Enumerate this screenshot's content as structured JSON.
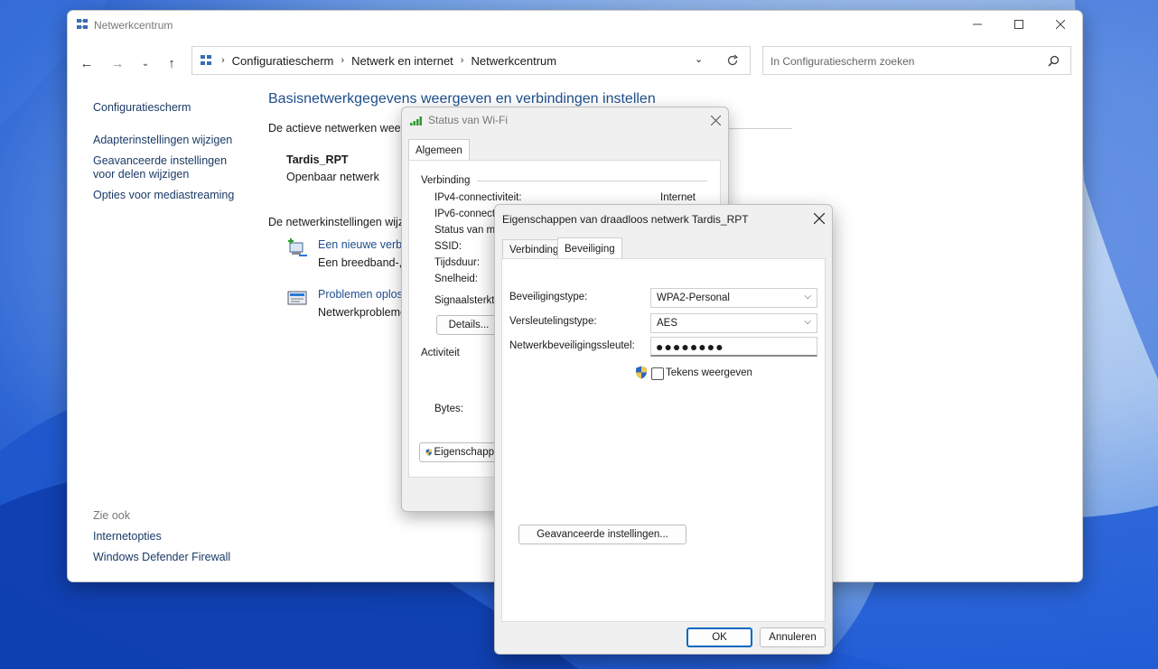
{
  "main_window": {
    "title": "Netwerkcentrum",
    "breadcrumbs": [
      "Configuratiescherm",
      "Netwerk en internet",
      "Netwerkcentrum"
    ],
    "search_placeholder": "In Configuratiescherm zoeken",
    "sidebar": {
      "home": "Configuratiescherm",
      "links": [
        "Adapterinstellingen wijzigen",
        "Geavanceerde instellingen voor delen wijzigen",
        "Opties voor mediastreaming"
      ],
      "see_also_title": "Zie ook",
      "see_also": [
        "Internetopties",
        "Windows Defender Firewall"
      ]
    },
    "content": {
      "title": "Basisnetwerkgegevens weergeven en verbindingen instellen",
      "active_networks_label": "De actieve netwerken weerg",
      "network_name": "Tardis_RPT",
      "network_type": "Openbaar netwerk",
      "change_settings_label": "De netwerkinstellingen wijzig",
      "task_new": {
        "link": "Een nieuwe verbin",
        "desc": "Een breedband-, i"
      },
      "task_troubleshoot": {
        "link": "Problemen oploss",
        "desc": "Netwerkproblemen"
      }
    }
  },
  "wifi_status": {
    "title": "Status van Wi-Fi",
    "tab": "Algemeen",
    "connection_group": "Verbinding",
    "rows": [
      {
        "label": "IPv4-connectiviteit:",
        "value": "Internet"
      },
      {
        "label": "IPv6-connecti",
        "value": ""
      },
      {
        "label": "Status van me",
        "value": ""
      },
      {
        "label": "SSID:",
        "value": ""
      },
      {
        "label": "Tijdsduur:",
        "value": ""
      },
      {
        "label": "Snelheid:",
        "value": ""
      }
    ],
    "signal_label": "Signaalsterkte",
    "details_button": "Details...",
    "activity_group": "Activiteit",
    "bytes_label": "Bytes:",
    "properties_button": "Eigenschapp"
  },
  "props_dialog": {
    "title": "Eigenschappen van draadloos netwerk Tardis_RPT",
    "tabs": [
      "Verbinding",
      "Beveiliging"
    ],
    "security_type_label": "Beveiligingstype:",
    "security_type_value": "WPA2-Personal",
    "encryption_label": "Versleutelingstype:",
    "encryption_value": "AES",
    "key_label": "Netwerkbeveiligingssleutel:",
    "key_value": "●●●●●●●●",
    "show_chars_label": "Tekens weergeven",
    "show_chars_checked": false,
    "advanced_button": "Geavanceerde instellingen...",
    "ok_button": "OK",
    "cancel_button": "Annuleren"
  },
  "colors": {
    "accent": "#0067c0",
    "link": "#1a3a66",
    "heading": "#1e4e8c"
  }
}
